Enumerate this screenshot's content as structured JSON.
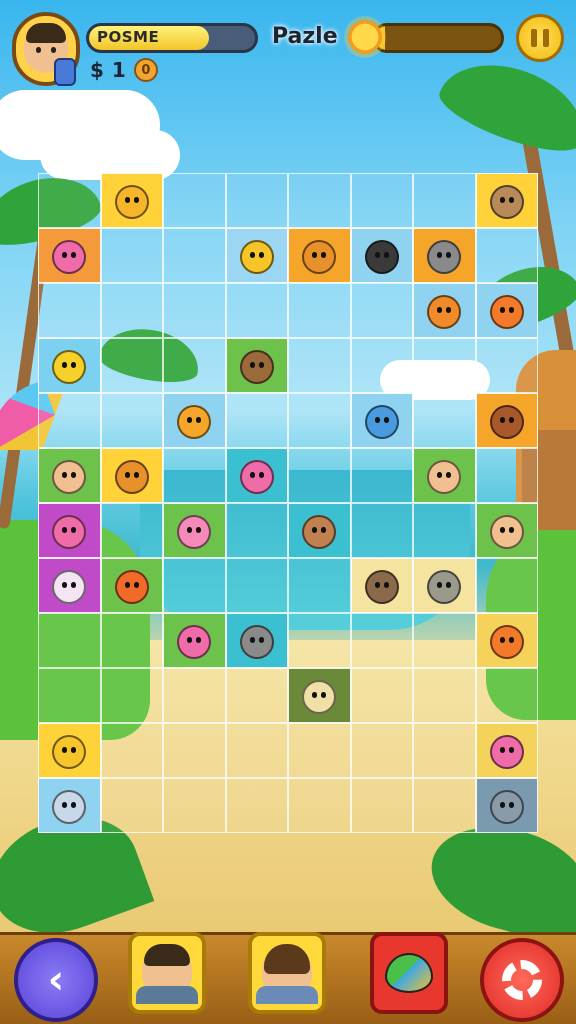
{
  "hud": {
    "player_name": "POSME",
    "name_progress": 0.72,
    "currency_symbol": "$",
    "currency_value": "1",
    "coin_glyph": "0",
    "title": "Pazle",
    "sun_progress": 0.08
  },
  "colors": {
    "hud_bar_fill": "#f2c42a",
    "pause_button": "#f2b80f",
    "back_button": "#5a43d8",
    "settings_button": "#e02a25",
    "bird_button": "#e8382e",
    "toolbar": "#b77a22"
  },
  "board": {
    "columns": 8,
    "rows": 11,
    "pieces": [
      {
        "row": 0,
        "col": 1,
        "animal": "yellow-dog",
        "bg": "#ffd23a",
        "body": "#f7b52a"
      },
      {
        "row": 0,
        "col": 7,
        "animal": "owl",
        "bg": "#ffd23a",
        "body": "#b88a5a"
      },
      {
        "row": 1,
        "col": 0,
        "animal": "pink-llama",
        "bg": "#f59a3a",
        "body": "#f06ca8"
      },
      {
        "row": 1,
        "col": 3,
        "animal": "yellow-llama",
        "bg": "#9bd7f2",
        "body": "#f5c52a"
      },
      {
        "row": 1,
        "col": 4,
        "animal": "bear",
        "bg": "#f5a52a",
        "body": "#e8912a"
      },
      {
        "row": 1,
        "col": 5,
        "animal": "crow",
        "bg": "#8fd3f0",
        "body": "#3a3a3a"
      },
      {
        "row": 1,
        "col": 6,
        "animal": "raccoon",
        "bg": "#f5a52a",
        "body": "#8a8a8a"
      },
      {
        "row": 2,
        "col": 6,
        "animal": "tiger",
        "bg": "#8fd3f0",
        "body": "#f08a2a"
      },
      {
        "row": 2,
        "col": 7,
        "animal": "fox",
        "bg": "#8fd3f0",
        "body": "#f27a2a"
      },
      {
        "row": 3,
        "col": 0,
        "animal": "yellow-bird",
        "bg": "#7cd0f0",
        "body": "#f5d22a"
      },
      {
        "row": 3,
        "col": 3,
        "animal": "monkey",
        "bg": "#6cc24a",
        "body": "#9a6a3a"
      },
      {
        "row": 4,
        "col": 2,
        "animal": "cat",
        "bg": "#8fd3f0",
        "body": "#f5a52a"
      },
      {
        "row": 4,
        "col": 5,
        "animal": "blue-bird",
        "bg": "#8fd3f0",
        "body": "#4a9ae0"
      },
      {
        "row": 4,
        "col": 7,
        "animal": "horse",
        "bg": "#f5a52a",
        "body": "#a8582a"
      },
      {
        "row": 5,
        "col": 0,
        "animal": "boy",
        "bg": "#6cc24a",
        "body": "#f0c090"
      },
      {
        "row": 5,
        "col": 1,
        "animal": "kiwi",
        "bg": "#ffd23a",
        "body": "#e8912a"
      },
      {
        "row": 5,
        "col": 3,
        "animal": "pink-seal",
        "bg": "#3ac0d0",
        "body": "#f06ca8"
      },
      {
        "row": 5,
        "col": 6,
        "animal": "man",
        "bg": "#6cc24a",
        "body": "#f0c090"
      },
      {
        "row": 6,
        "col": 0,
        "animal": "pink-cat",
        "bg": "#c04ac8",
        "body": "#f06ca8"
      },
      {
        "row": 6,
        "col": 2,
        "animal": "pink-pig",
        "bg": "#6cc24a",
        "body": "#f58ab8"
      },
      {
        "row": 6,
        "col": 4,
        "animal": "squirrel",
        "bg": "#3ac0d0",
        "body": "#c08050"
      },
      {
        "row": 6,
        "col": 7,
        "animal": "girl",
        "bg": "#6cc24a",
        "body": "#f0c090"
      },
      {
        "row": 7,
        "col": 0,
        "animal": "white-cat",
        "bg": "#c04ac8",
        "body": "#f4e4f4"
      },
      {
        "row": 7,
        "col": 1,
        "animal": "parrot",
        "bg": "#6cc24a",
        "body": "#f26a2a"
      },
      {
        "row": 7,
        "col": 5,
        "animal": "bear-cub",
        "bg": "#f5e3a0",
        "body": "#8a6a4a"
      },
      {
        "row": 7,
        "col": 6,
        "animal": "raccoon-small",
        "bg": "#f5e3a0",
        "body": "#9a9a8a"
      },
      {
        "row": 8,
        "col": 2,
        "animal": "pink-bird",
        "bg": "#6cc24a",
        "body": "#f06ca8"
      },
      {
        "row": 8,
        "col": 3,
        "animal": "elephant",
        "bg": "#3ac0d0",
        "body": "#8a8a8a"
      },
      {
        "row": 8,
        "col": 7,
        "animal": "orange-fish",
        "bg": "#f5d25a",
        "body": "#f27a2a"
      },
      {
        "row": 9,
        "col": 4,
        "animal": "crayon",
        "bg": "#6a8a3a",
        "body": "#f0e0a8"
      },
      {
        "row": 10,
        "col": 0,
        "animal": "duck",
        "bg": "#ffd23a",
        "body": "#f5c52a"
      },
      {
        "row": 10,
        "col": 7,
        "animal": "pink-fish",
        "bg": "#f5d25a",
        "body": "#f06ca8"
      },
      {
        "row": 11,
        "col": 0,
        "animal": "seal",
        "bg": "#8fd3f0",
        "body": "#c8d8e8"
      },
      {
        "row": 11,
        "col": 7,
        "animal": "dolphin",
        "bg": "#7a9ab0",
        "body": "#8a9aa8"
      }
    ]
  },
  "toolbar": {
    "back_glyph": "‹",
    "items": [
      {
        "name": "boy-piece-button",
        "kind": "face",
        "hair": "#3a2a1a"
      },
      {
        "name": "girl-piece-button",
        "kind": "face",
        "hair": "#5a3a1a"
      },
      {
        "name": "bird-piece-button",
        "kind": "bird"
      }
    ]
  }
}
